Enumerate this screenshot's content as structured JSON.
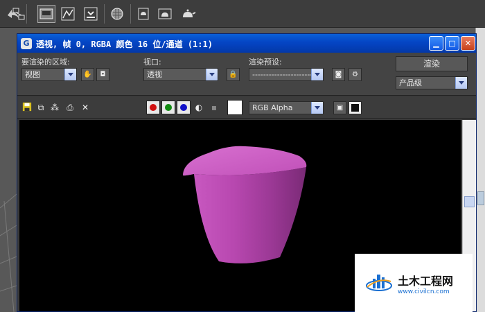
{
  "render_window": {
    "title": "透视, 帧 0, RGBA 颜色 16 位/通道 (1:1)",
    "window_controls": {
      "minimize": "▁",
      "maximize": "□",
      "close": "✕"
    }
  },
  "settings": {
    "area_label": "要渲染的区域:",
    "area_value": "视图",
    "viewport_label": "视口:",
    "viewport_value": "透视",
    "preset_label": "渲染预设:",
    "preset_value": "--------------------------",
    "render_button": "渲染",
    "quality_value": "产品级"
  },
  "framebuffer": {
    "channel_value": "RGB Alpha",
    "channels": [
      {
        "name": "red",
        "color": "#d01010"
      },
      {
        "name": "green",
        "color": "#108a10"
      },
      {
        "name": "blue",
        "color": "#1010c8"
      }
    ]
  },
  "render": {
    "background": "#000000",
    "object_color": "#c050b8"
  },
  "watermark": {
    "title": "土木工程网",
    "url": "www.civilcn.com"
  }
}
